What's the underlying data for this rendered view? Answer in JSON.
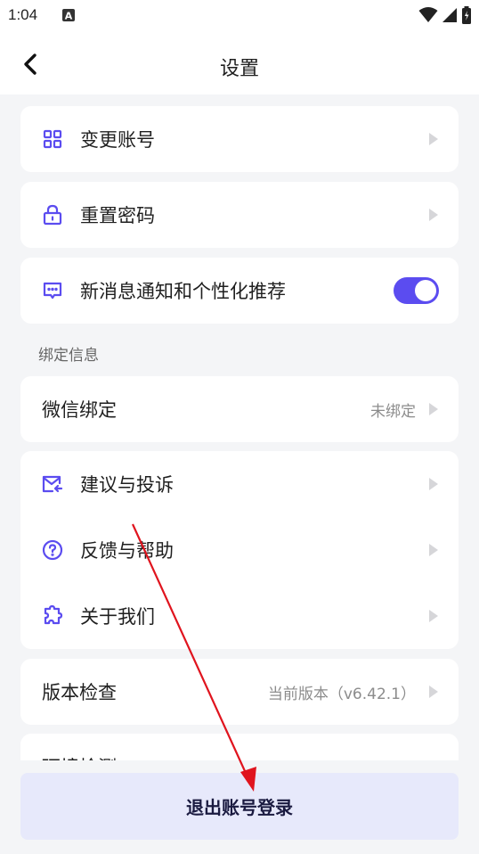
{
  "status_bar": {
    "time": "1:04",
    "notification_icon": "A"
  },
  "nav": {
    "title": "设置"
  },
  "account": {
    "change_account": "变更账号",
    "reset_password": "重置密码",
    "notifications": "新消息通知和个性化推荐",
    "notifications_enabled": true
  },
  "binding": {
    "section_label": "绑定信息",
    "wechat_label": "微信绑定",
    "wechat_status": "未绑定"
  },
  "support": {
    "suggest": "建议与投诉",
    "feedback": "反馈与帮助",
    "about": "关于我们"
  },
  "version": {
    "label": "版本检查",
    "value": "当前版本（v6.42.1）"
  },
  "network": {
    "label": "环境检测"
  },
  "footer": {
    "logout_label": "退出账号登录"
  },
  "colors": {
    "accent": "#5b4cf0",
    "annotation": "#e0141e",
    "logout_bg": "#e7e9fb"
  }
}
